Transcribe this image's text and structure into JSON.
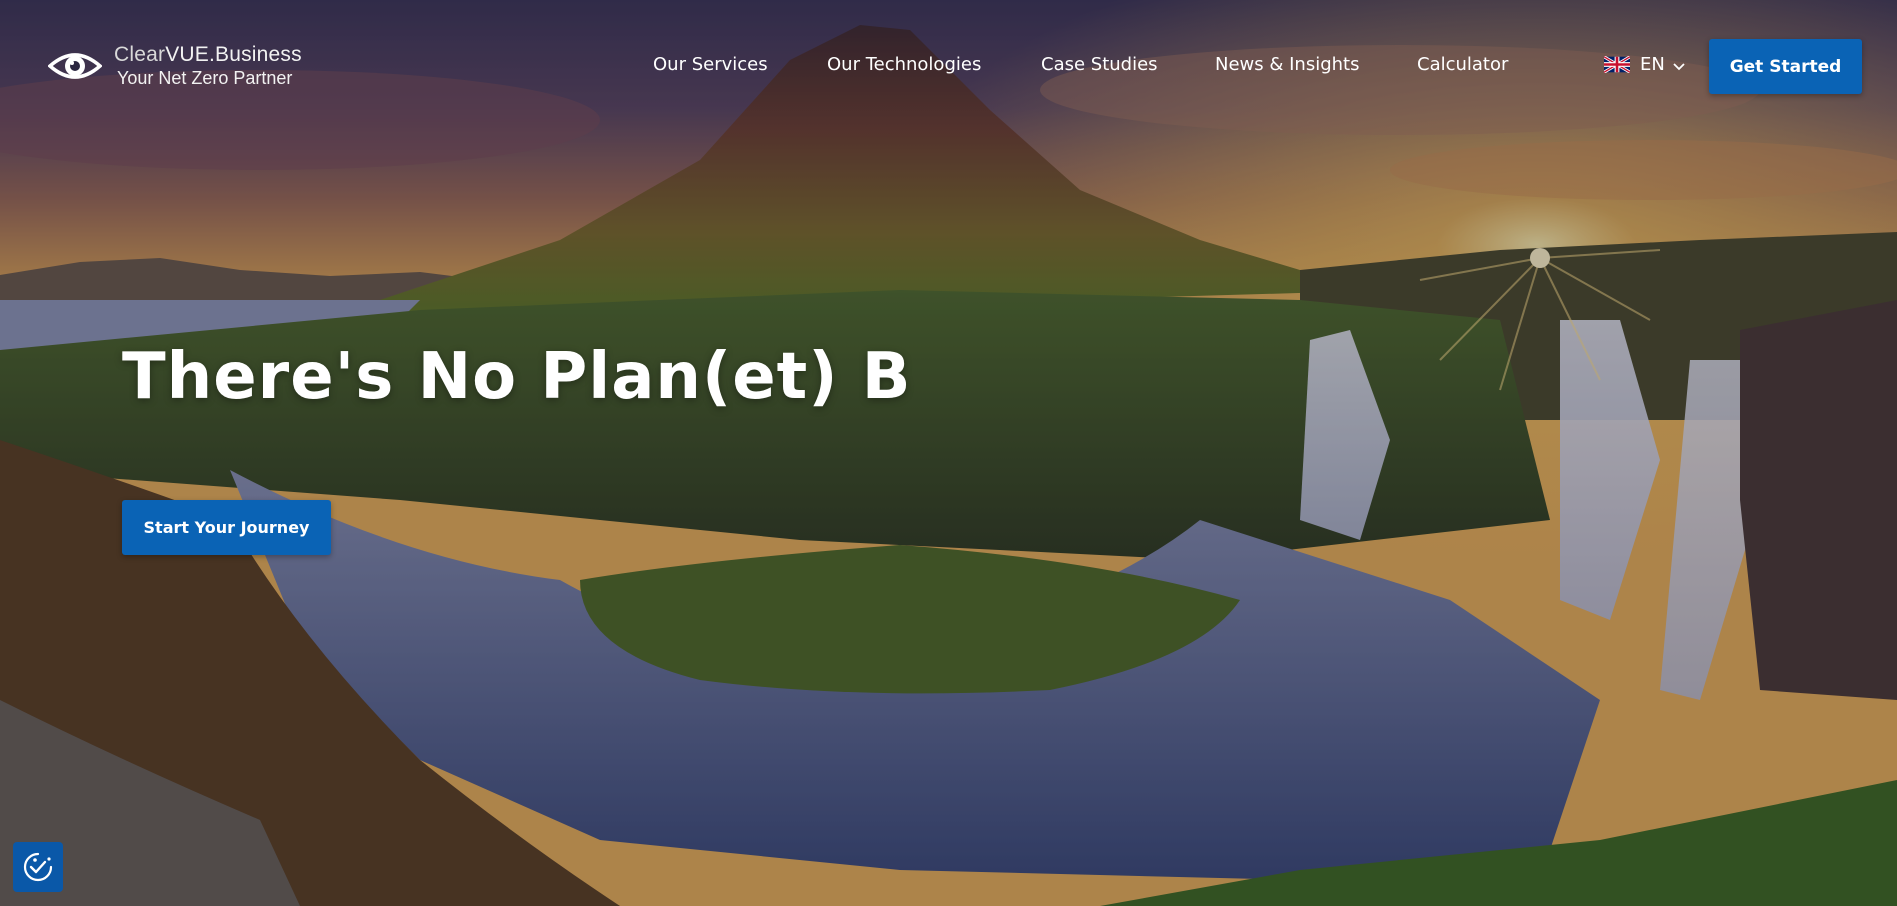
{
  "brand": {
    "name_part1": "Clear",
    "name_part2": "VUE",
    "name_part3": ".Business",
    "tagline": "Your Net Zero Partner",
    "icon": "eye-logo-icon"
  },
  "nav": {
    "items": [
      {
        "label": "Our Services"
      },
      {
        "label": "Our Technologies"
      },
      {
        "label": "Case Studies"
      },
      {
        "label": "News & Insights"
      },
      {
        "label": "Calculator"
      }
    ],
    "language": {
      "label": "EN",
      "flag_icon": "uk-flag-icon",
      "chevron_icon": "chevron-down-icon"
    },
    "cta_label": "Get Started"
  },
  "hero": {
    "headline": "There's No Plan(et) B",
    "cta_label": "Start Your Journey"
  },
  "accessibility": {
    "icon": "accessibility-check-icon"
  },
  "colors": {
    "accent": "#0a63b5"
  }
}
